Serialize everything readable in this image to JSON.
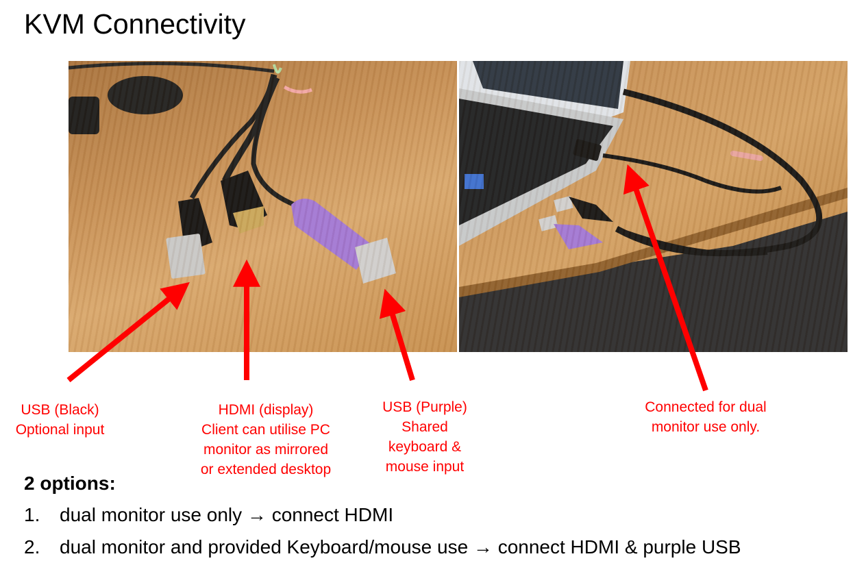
{
  "slide": {
    "title": "KVM Connectivity"
  },
  "photos": {
    "left": {
      "alt": "KVM cable ends: black USB, HDMI, purple USB connectors on wooden desk"
    },
    "right": {
      "alt": "Laptop with KVM HDMI connected, USB plugs lying on desk"
    }
  },
  "captions": {
    "usb_black": {
      "line1": "USB (Black)",
      "line2": "Optional input"
    },
    "hdmi": {
      "line1": "HDMI (display)",
      "line2": "Client can utilise PC",
      "line3": "monitor as mirrored",
      "line4": "or extended desktop"
    },
    "usb_purple": {
      "line1": "USB (Purple)",
      "line2": "Shared",
      "line3": "keyboard &",
      "line4": "mouse input"
    },
    "connected": {
      "line1": "Connected for dual",
      "line2": "monitor use only."
    }
  },
  "options": {
    "heading": "2 options:",
    "items": [
      {
        "number": "1.",
        "text": "dual monitor use only → connect HDMI"
      },
      {
        "number": "2.",
        "text": "dual monitor and provided Keyboard/mouse use → connect HDMI & purple USB"
      }
    ]
  },
  "colors": {
    "annotation": "#ff0000",
    "usb_purple": "#a277d6",
    "cable_black": "#1c1c1c",
    "wood": "#cf9a5c"
  }
}
